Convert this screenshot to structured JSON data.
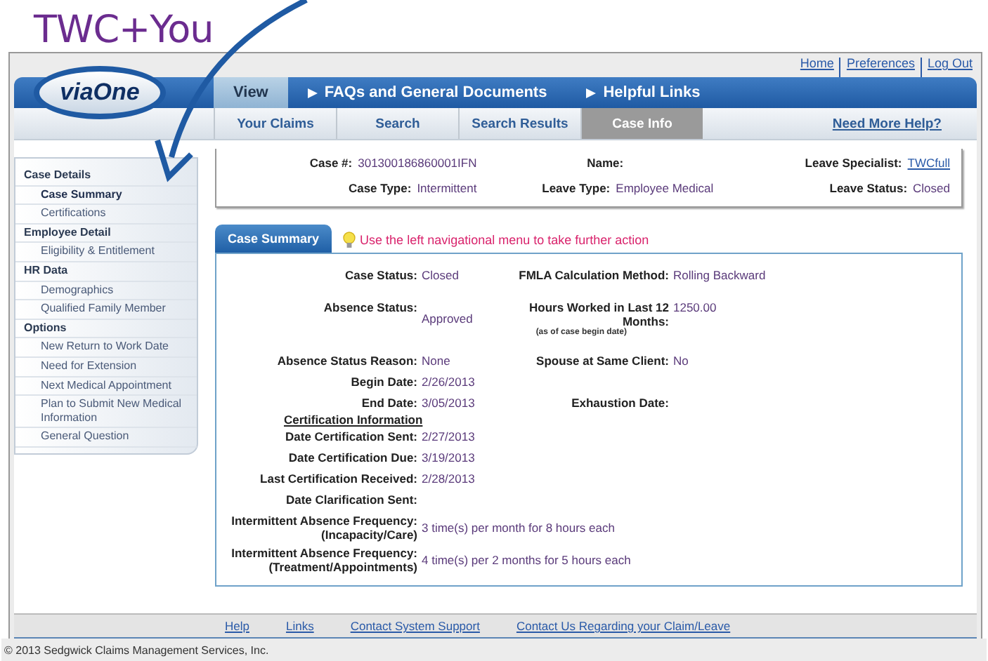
{
  "brand": "TWC+You",
  "top_links": [
    "Home",
    "Preferences",
    "Log Out"
  ],
  "logo": "viaOne",
  "main_menu": [
    {
      "label": "View",
      "selected": true,
      "arrow": false
    },
    {
      "label": "FAQs and General Documents",
      "selected": false,
      "arrow": true
    },
    {
      "label": "Helpful Links",
      "selected": false,
      "arrow": true
    }
  ],
  "tabs": [
    {
      "label": "Your Claims",
      "selected": false
    },
    {
      "label": "Search",
      "selected": false
    },
    {
      "label": "Search Results",
      "selected": false
    },
    {
      "label": "Case Info",
      "selected": true
    }
  ],
  "help_link": "Need More Help?",
  "sidebar": [
    {
      "header": "Case Details",
      "items": [
        {
          "label": "Case Summary",
          "selected": true
        },
        {
          "label": "Certifications",
          "selected": false
        }
      ]
    },
    {
      "header": "Employee Detail",
      "items": [
        {
          "label": "Eligibility & Entitlement",
          "selected": false
        }
      ]
    },
    {
      "header": "HR Data",
      "items": [
        {
          "label": "Demographics",
          "selected": false
        },
        {
          "label": "Qualified Family Member",
          "selected": false
        }
      ]
    },
    {
      "header": "Options",
      "items": [
        {
          "label": "New Return to Work Date",
          "selected": false
        },
        {
          "label": "Need for Extension",
          "selected": false
        },
        {
          "label": "Next Medical Appointment",
          "selected": false
        },
        {
          "label": "Plan to Submit New Medical Information",
          "selected": false
        },
        {
          "label": "General Question",
          "selected": false
        }
      ]
    }
  ],
  "case_header": [
    [
      {
        "label": "Case #:",
        "value": "301300186860001IFN"
      },
      {
        "label": "Name:"
      },
      {
        "label": "Leave Specialist:",
        "value": "TWCfull",
        "kind": "link"
      }
    ],
    [
      {
        "label": "Case Type:",
        "value": "Intermittent"
      },
      {
        "label": "Leave Type:",
        "value": "Employee Medical"
      },
      {
        "label": "Leave Status:",
        "value": "Closed"
      }
    ]
  ],
  "panel_tab": "Case Summary",
  "hint": "Use the left navigational menu to take further action",
  "summary_rows": [
    {
      "kind": "pair",
      "left": {
        "label": "Case Status:",
        "value": "Closed"
      },
      "right": {
        "label": "FMLA Calculation Method:",
        "value": "Rolling Backward"
      }
    },
    {
      "kind": "pair",
      "left": {
        "label": "Absence Status:",
        "value": "Approved"
      },
      "right": {
        "label": "Hours Worked in Last 12 Months:",
        "value": "1250.00",
        "note": "(as of case begin date)"
      }
    },
    {
      "kind": "pair",
      "left": {
        "label": "Absence Status Reason:",
        "value": "None"
      },
      "right": {
        "label": "Spouse at Same Client:",
        "value": "No"
      }
    },
    {
      "kind": "pair",
      "left": {
        "label": "Begin Date:",
        "value": "2/26/2013"
      }
    },
    {
      "kind": "pair",
      "left": {
        "label": "End Date:",
        "value": "3/05/2013"
      },
      "right": {
        "label": "Exhaustion Date:"
      }
    },
    {
      "kind": "heading",
      "text": "Certification Information"
    },
    {
      "kind": "pair",
      "left": {
        "label": "Date Certification Sent:",
        "value": "2/27/2013"
      }
    },
    {
      "kind": "pair",
      "left": {
        "label": "Date Certification Due:",
        "value": "3/19/2013"
      }
    },
    {
      "kind": "pair",
      "left": {
        "label": "Last Certification Received:",
        "value": "2/28/2013"
      }
    },
    {
      "kind": "pair",
      "left": {
        "label": "Date Clarification Sent:"
      }
    },
    {
      "kind": "pair",
      "left": {
        "label": "Intermittent Absence Frequency:\n(Incapacity/Care)",
        "value": "3 time(s) per month for 8 hours each"
      }
    },
    {
      "kind": "pair",
      "left": {
        "label": "Intermittent Absence Frequency:\n(Treatment/Appointments)",
        "value": "4 time(s) per 2 months for 5 hours each"
      }
    }
  ],
  "footer_links": [
    "Help",
    "Links",
    "Contact System Support",
    "Contact Us Regarding your Claim/Leave"
  ],
  "copyright": "© 2013 Sedgwick Claims Management Services, Inc."
}
